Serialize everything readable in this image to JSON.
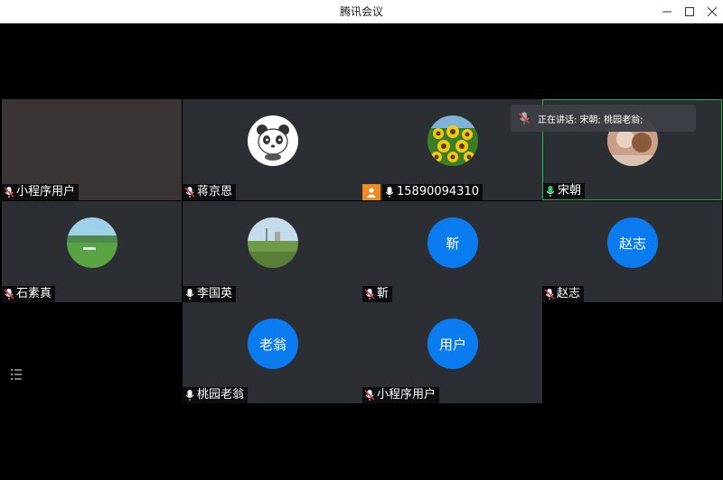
{
  "window": {
    "title": "腾讯会议"
  },
  "speaking_indicator": {
    "text": "正在讲话: 宋朝; 桃园老翁;"
  },
  "participants": [
    {
      "name": "小程序用户",
      "mic": "muted",
      "avatar": "blank"
    },
    {
      "name": "蒋京恩",
      "mic": "muted",
      "avatar": "panda-image"
    },
    {
      "name": "15890094310",
      "mic": "on",
      "avatar": "sunflower-image",
      "host": true
    },
    {
      "name": "宋朝",
      "mic": "speaking",
      "avatar": "photo-image",
      "active": true
    },
    {
      "name": "石素真",
      "mic": "muted",
      "avatar": "grassland-image"
    },
    {
      "name": "李国英",
      "mic": "on",
      "avatar": "landscape-image"
    },
    {
      "name": "靳",
      "mic": "muted",
      "avatar_text": "靳"
    },
    {
      "name": "赵志",
      "mic": "muted",
      "avatar_text": "赵志"
    },
    {
      "name": "桃园老翁",
      "mic": "on",
      "avatar_text": "老翁"
    },
    {
      "name": "小程序用户",
      "mic": "muted",
      "avatar_text": "用户"
    }
  ],
  "colors": {
    "tile_bg": "#2b2f33",
    "avatar_blue": "#0a7cf0",
    "active_border": "#1fb456",
    "host_orange": "#f08a25",
    "mute_red": "#e0322f"
  }
}
